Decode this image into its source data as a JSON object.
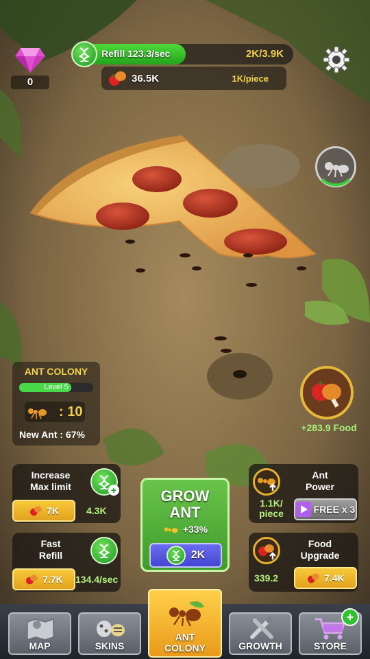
{
  "hud": {
    "gems": "0",
    "refill_label": "Refill 123.3/sec",
    "refill_capacity": "2K/3.9K",
    "refill_fraction": 0.51,
    "food_amount": "36.5K",
    "food_per_piece": "1K/piece"
  },
  "colony": {
    "title": "ANT COLONY",
    "level": "Level 5",
    "level_fraction": 0.7,
    "ant_count": ": 10",
    "new_ant": "New Ant : 67%"
  },
  "food_rate": "+283.9 Food",
  "upgrades": {
    "max_limit": {
      "title_line1": "Increase",
      "title_line2": "Max limit",
      "cost": "7K",
      "value": "4.3K"
    },
    "fast_refill": {
      "title_line1": "Fast",
      "title_line2": "Refill",
      "cost": "7.7K",
      "value": "134.4/sec"
    },
    "ant_power": {
      "title_line1": "Ant",
      "title_line2": "Power",
      "value_line1": "1.1K/",
      "value_line2": "piece",
      "free_label": "FREE x 3"
    },
    "food_upgrade": {
      "title_line1": "Food",
      "title_line2": "Upgrade",
      "value": "339.2",
      "cost": "7.4K"
    }
  },
  "grow": {
    "title_line1": "GROW",
    "title_line2": "ANT",
    "bonus": "+33%",
    "cost": "2K"
  },
  "nav": {
    "map": "MAP",
    "skins": "SKINS",
    "colony_line1": "ANT",
    "colony_line2": "COLONY",
    "growth": "GROWTH",
    "store": "STORE"
  },
  "icons": {
    "gem": "gem-icon",
    "dna": "dna-icon",
    "food": "food-icon",
    "settings": "gear-icon",
    "ant": "ant-icon"
  },
  "colors": {
    "accent_green": "#3fb52d",
    "accent_yellow": "#f3d34a",
    "cost_orange": "#e9a51f",
    "grow_cost_blue": "#4b4dd8"
  }
}
